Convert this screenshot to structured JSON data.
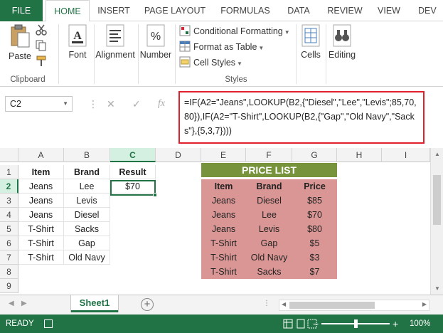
{
  "tabs": [
    {
      "label": "FILE"
    },
    {
      "label": "HOME"
    },
    {
      "label": "INSERT"
    },
    {
      "label": "PAGE LAYOUT"
    },
    {
      "label": "FORMULAS"
    },
    {
      "label": "DATA"
    },
    {
      "label": "REVIEW"
    },
    {
      "label": "VIEW"
    },
    {
      "label": "DEV"
    }
  ],
  "ribbon": {
    "paste": "Paste",
    "clipboard": "Clipboard",
    "font": "Font",
    "alignment": "Alignment",
    "number": "Number",
    "conditional_formatting": "Conditional Formatting",
    "format_as_table": "Format as Table",
    "cell_styles": "Cell Styles",
    "styles": "Styles",
    "cells": "Cells",
    "editing": "Editing"
  },
  "formula_bar": {
    "name_box": "C2",
    "fx": "fx",
    "formula": "=IF(A2=\"Jeans\",LOOKUP(B2,{\"Diesel\",\"Lee\",\"Levis\";85,70,80}),IF(A2=\"T-Shirt\",LOOKUP(B2,{\"Gap\",\"Old Navy\",\"Sacks\"},{5,3,7})))"
  },
  "columns": [
    "A",
    "B",
    "C",
    "D",
    "E",
    "F",
    "G",
    "H",
    "I"
  ],
  "rows": [
    "1",
    "2",
    "3",
    "4",
    "5",
    "6",
    "7",
    "8",
    "9"
  ],
  "table": {
    "headers": [
      "Item",
      "Brand",
      "Result"
    ],
    "rows": [
      [
        "Jeans",
        "Lee",
        "$70"
      ],
      [
        "Jeans",
        "Levis",
        ""
      ],
      [
        "Jeans",
        "Diesel",
        ""
      ],
      [
        "T-Shirt",
        "Sacks",
        ""
      ],
      [
        "T-Shirt",
        "Gap",
        ""
      ],
      [
        "T-Shirt",
        "Old Navy",
        ""
      ]
    ]
  },
  "price_list": {
    "title": "PRICE LIST",
    "headers": [
      "Item",
      "Brand",
      "Price"
    ],
    "rows": [
      [
        "Jeans",
        "Diesel",
        "$85"
      ],
      [
        "Jeans",
        "Lee",
        "$70"
      ],
      [
        "Jeans",
        "Levis",
        "$80"
      ],
      [
        "T-Shirt",
        "Gap",
        "$5"
      ],
      [
        "T-Shirt",
        "Old Navy",
        "$3"
      ],
      [
        "T-Shirt",
        "Sacks",
        "$7"
      ]
    ]
  },
  "sheet_tab": "Sheet1",
  "status": {
    "ready": "READY",
    "zoom": "100%"
  },
  "colors": {
    "excel_green": "#217346",
    "price_title_bg": "#77933c",
    "price_body_bg": "#da9694",
    "highlight_border": "#e0202a"
  }
}
